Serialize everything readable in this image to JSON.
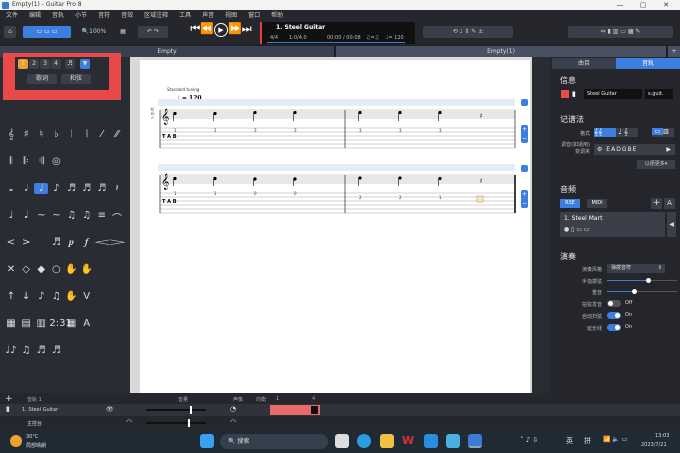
{
  "window": {
    "title": "Empty(1) - Guitar Pro 8",
    "minimize": "—",
    "maximize": "▢",
    "close": "✕"
  },
  "menu": [
    "文件",
    "编辑",
    "音轨",
    "小节",
    "音符",
    "音效",
    "区域注释",
    "工具",
    "声音",
    "视图",
    "窗口",
    "帮助"
  ],
  "toolbar": {
    "zoom": "100%",
    "lcd": {
      "track": "1. Steel Guitar",
      "signature": "4/4",
      "position": "1:0/4.0",
      "time": "00:00 / 00:08",
      "tempo": "♩= 120",
      "triplet": "♫=♫"
    }
  },
  "tabs": [
    {
      "label": "Empty"
    },
    {
      "label": "Empty(1)"
    }
  ],
  "left_panel": {
    "voices": [
      "1",
      "2",
      "3",
      "4"
    ],
    "buttons": [
      "歌词",
      "和弦"
    ],
    "palette": [
      [
        "𝄞",
        "♯",
        "♮",
        "♭",
        "𝄀",
        "𝄁",
        "⁄",
        "⁄⁄"
      ],
      [
        "𝄃",
        "𝄆",
        "𝄇",
        "◎",
        "",
        "",
        "",
        ""
      ],
      [
        "𝅝",
        "𝅗𝅥",
        "♩",
        "♪",
        "♬",
        "♬",
        "♬",
        "𝄽"
      ],
      [
        "♩",
        "𝅘𝅥",
        "~",
        "~",
        "♫",
        "♫",
        "≡",
        "⌒"
      ],
      [
        "<",
        ">",
        "",
        "♬",
        "𝆏",
        "𝆑",
        "𝆒",
        "𝆓"
      ],
      [
        "✕",
        "◇",
        "◆",
        "○",
        "✋",
        "✋",
        "",
        ""
      ],
      [
        "↑",
        "↓",
        "♪",
        "♫",
        "✋",
        "V",
        "",
        ""
      ],
      [
        "▦",
        "▤",
        "▥",
        "2:31",
        "▦",
        "A",
        "",
        ""
      ],
      [
        "♩♪",
        "♫",
        "♬",
        "♬",
        "",
        "",
        "",
        ""
      ]
    ]
  },
  "score": {
    "tuning_label": "Standard tuning",
    "tempo": "♩ = 120",
    "track_short": "s.guit.",
    "system1": {
      "tab": [
        [
          "1",
          "1",
          "3",
          "3"
        ],
        [
          "3",
          "3",
          "3",
          ""
        ]
      ]
    },
    "system2": {
      "tab": [
        [
          "1",
          "1",
          "0",
          "0"
        ],
        [
          "2",
          "2",
          "1",
          ""
        ]
      ]
    }
  },
  "right_panel": {
    "tabs": [
      "曲目",
      "音轨"
    ],
    "active_tab": 1,
    "info_title": "信息",
    "track_name": "Steel Guitar",
    "short_name": "s.guit.",
    "notation_title": "记谱法",
    "format_label": "格式",
    "tuning_label": "调音(如适用)",
    "capo_label": "变调夹",
    "tuning_value": "EADGBE",
    "more_label": "以便更多▾",
    "audio_title": "音频",
    "audio_tabs": [
      "RSE",
      "MIDI"
    ],
    "sound": "1. Steel Mart",
    "play_title": "演奏",
    "style_label": "演奏风格",
    "style_value": "弹拨音符",
    "fingering_label": "手指拨弦",
    "accent_label": "重音",
    "slider_values": [
      0.3,
      0.1
    ],
    "toggles": [
      {
        "label": "拍弦发音",
        "state": "Off"
      },
      {
        "label": "自动扫弦",
        "state": "On"
      },
      {
        "label": "延长线",
        "state": "On"
      }
    ]
  },
  "bottom": {
    "header": "音轨 1",
    "volume_label": "音量",
    "pan_label": "声像",
    "eq_label": "均衡",
    "bar_numbers": [
      "1",
      "4"
    ],
    "tracks": [
      {
        "name": "1. Steel Guitar"
      },
      {
        "name": "主控台"
      }
    ]
  },
  "taskbar": {
    "weather_temp": "30°C",
    "weather_desc": "局部晴朗",
    "search": "搜索",
    "ime1": "英",
    "ime2": "拼",
    "time": "13:03",
    "date": "2023/7/21"
  },
  "colors": {
    "accent": "#3d7fe0",
    "highlight": "#e84a4a",
    "voice1": "#f0a030"
  }
}
